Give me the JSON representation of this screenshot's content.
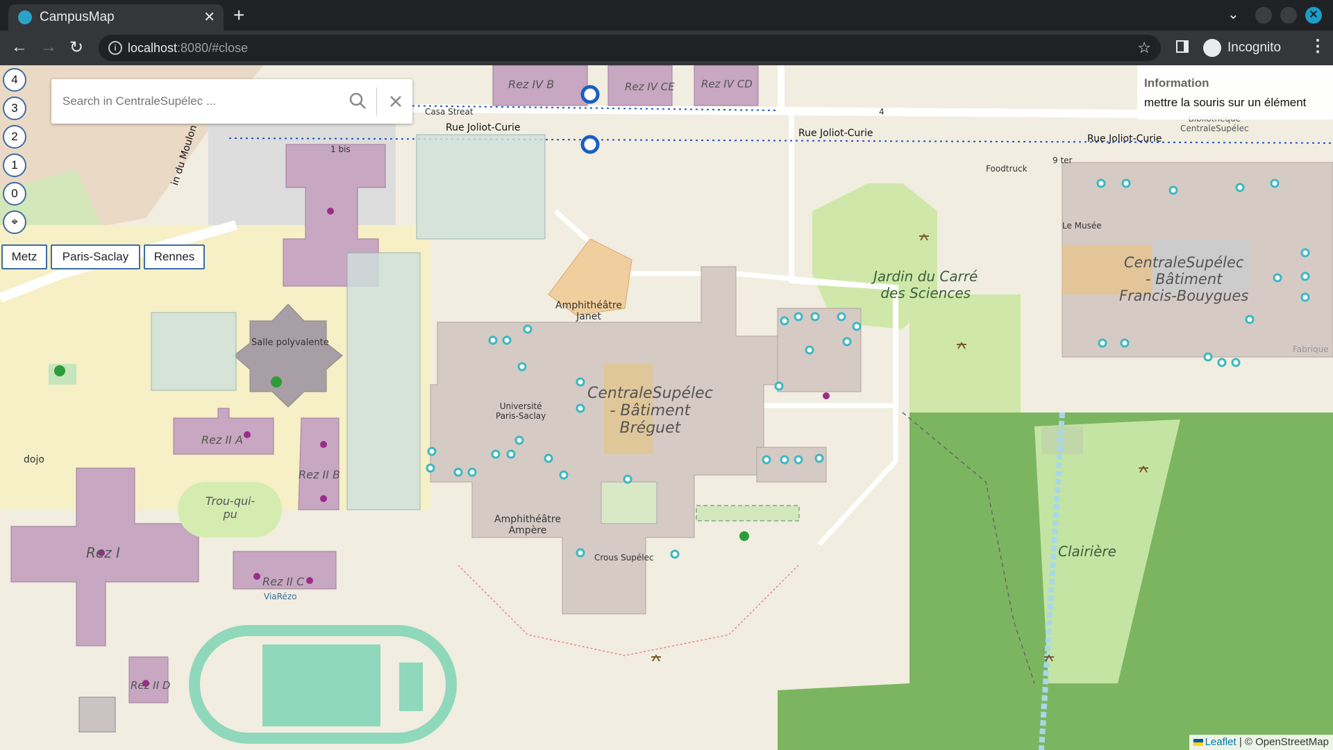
{
  "browser": {
    "tab_title": "CampusMap",
    "url_host": "localhost",
    "url_path": ":8080/#close",
    "profile_label": "Incognito"
  },
  "map": {
    "floor_buttons": [
      "4",
      "3",
      "2",
      "1",
      "0",
      "⌖"
    ],
    "campus_buttons": [
      "Metz",
      "Paris-Saclay",
      "Rennes"
    ],
    "search": {
      "placeholder": "Search in CentraleSupélec ...",
      "value": ""
    },
    "info_panel": {
      "heading": "Information",
      "text": "mettre la souris sur un élément"
    },
    "attribution": {
      "leaflet": "Leaflet",
      "rest": "| © OpenStreetMap"
    },
    "labels": {
      "rue1": "Rue Joliot-Curie",
      "rue2": "Rue Joliot-Curie",
      "rue3": "Rue Joliot-Curie",
      "moulon": "in du Moulon",
      "jardin": "Jardin du Carré\ndes Sciences",
      "breguet": "CentraleSupélec\n- Bâtiment\nBréguet",
      "bouygues": "CentraleSupélec\n- Bâtiment\nFrancis-Bouygues",
      "clairiere": "Clairière",
      "amphi_janet": "Amphithéâtre\nJanet",
      "amphi_ampere": "Amphithéâtre\nAmpère",
      "crous": "Crous Supélec",
      "univ": "Université\nParis-Saclay",
      "rez_i": "Rez I",
      "rez_iia": "Rez II A",
      "rez_iib": "Rez II B",
      "rez_iic": "Rez II C",
      "rez_iid": "Rez II D",
      "rez_ivb": "Rez IV B",
      "rez_ivce": "Rez IV CE",
      "rez_ivcd": "Rez IV CD",
      "salle": "Salle polyvalente",
      "trou": "Trou-qui-\npu",
      "dojo": "dojo",
      "le_musee": "Le Musée",
      "foodtruck": "Foodtruck",
      "nine_ter": "9 ter",
      "one_bis": "1 bis",
      "casa": "Casa Streat",
      "viarezo": "ViaRézo",
      "biblio": "Bibliothèque\nCentraleSupélec",
      "four": "4",
      "fabrique": "Fabrique"
    }
  }
}
